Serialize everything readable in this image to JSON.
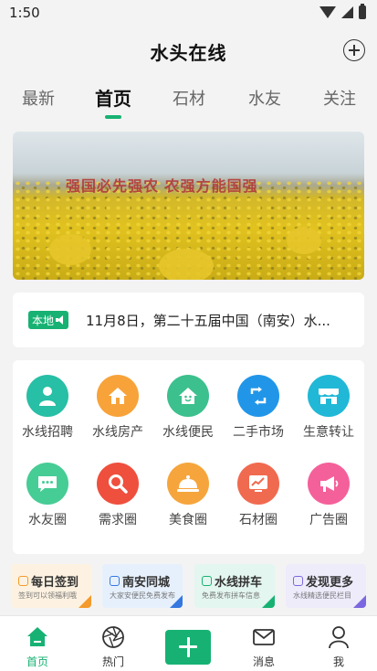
{
  "status_bar": {
    "time": "1:50"
  },
  "header": {
    "title": "水头在线",
    "add_icon": "plus-circle-icon"
  },
  "tabs": [
    {
      "label": "最新",
      "active": false
    },
    {
      "label": "首页",
      "active": true
    },
    {
      "label": "石材",
      "active": false
    },
    {
      "label": "水友",
      "active": false
    },
    {
      "label": "关注",
      "active": false
    }
  ],
  "banner": {
    "slogan": "强国必先强农 农强方能国强"
  },
  "notice": {
    "badge": "本地",
    "text": "11月8日，第二十五届中国（南安）水..."
  },
  "grid": [
    {
      "label": "水线招聘",
      "icon": "person-icon",
      "color": "#27bfa5"
    },
    {
      "label": "水线房产",
      "icon": "house-icon",
      "color": "#f7a33a"
    },
    {
      "label": "水线便民",
      "icon": "home-smile-icon",
      "color": "#3cc08d"
    },
    {
      "label": "二手市场",
      "icon": "exchange-icon",
      "color": "#2196e8"
    },
    {
      "label": "生意转让",
      "icon": "shop-icon",
      "color": "#20b8d6"
    },
    {
      "label": "水友圈",
      "icon": "chat-icon",
      "color": "#46cc95"
    },
    {
      "label": "需求圈",
      "icon": "search-icon",
      "color": "#ef4f3d"
    },
    {
      "label": "美食圈",
      "icon": "food-icon",
      "color": "#f6a53c"
    },
    {
      "label": "石材圈",
      "icon": "chart-icon",
      "color": "#f06a4f"
    },
    {
      "label": "广告圈",
      "icon": "megaphone-icon",
      "color": "#f4609a"
    }
  ],
  "shortcuts": [
    {
      "title": "每日签到",
      "subtitle": "签到可以领福利哦",
      "bg": "#fdf2e1",
      "accent": "#f39a2b"
    },
    {
      "title": "南安同城",
      "subtitle": "大家安便民免费发布",
      "bg": "#e6f0fc",
      "accent": "#3478e0"
    },
    {
      "title": "水线拼车",
      "subtitle": "免费发布拼车信息",
      "bg": "#e3f6ef",
      "accent": "#17b273"
    },
    {
      "title": "发现更多",
      "subtitle": "水线精选便民栏目",
      "bg": "#eeebfb",
      "accent": "#7b68e0"
    }
  ],
  "bottom_nav": [
    {
      "label": "首页",
      "icon": "home-icon",
      "active": true
    },
    {
      "label": "热门",
      "icon": "aperture-icon",
      "active": false
    },
    {
      "label": "",
      "icon": "plus-icon",
      "active": false
    },
    {
      "label": "消息",
      "icon": "mail-icon",
      "active": false
    },
    {
      "label": "我",
      "icon": "user-icon",
      "active": false
    }
  ],
  "colors": {
    "accent": "#17b273",
    "background": "#f3f3f3"
  }
}
